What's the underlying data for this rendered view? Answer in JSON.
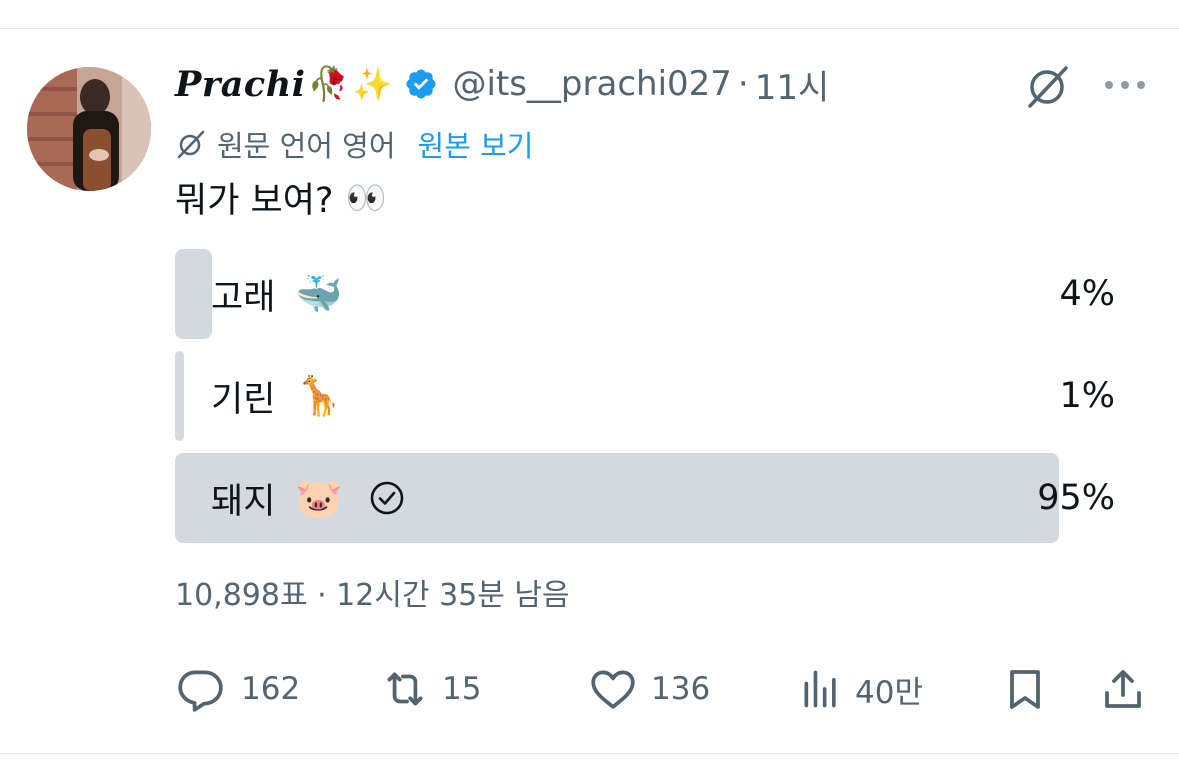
{
  "author": {
    "display_name": "Prachi",
    "name_emojis": [
      "🥀",
      "✨"
    ],
    "verified": true,
    "handle": "@its__prachi027",
    "separator": "·",
    "time": "11시"
  },
  "translation": {
    "label": "원문 언어 영어",
    "show_original": "원본 보기"
  },
  "tweet": {
    "text": "뭐가 보여?",
    "emoji": "👀"
  },
  "poll": {
    "options": [
      {
        "label": "고래",
        "emoji": "🐳",
        "percent_text": "4%",
        "percent": 4,
        "selected": false
      },
      {
        "label": "기린",
        "emoji": "🦒",
        "percent_text": "1%",
        "percent": 1,
        "selected": false
      },
      {
        "label": "돼지",
        "emoji": "🐷",
        "percent_text": "95%",
        "percent": 95,
        "selected": true
      }
    ],
    "meta": "10,898표 · 12시간 35분 남음"
  },
  "actions": {
    "replies": "162",
    "reposts": "15",
    "likes": "136",
    "views": "40만"
  },
  "colors": {
    "text_primary": "#0f1419",
    "text_secondary": "#536471",
    "link": "#1d9bf0",
    "verified": "#1d9bf0",
    "poll_bar": "#d3d9de"
  },
  "icons": {
    "grok": "grok-slash-icon",
    "more": "more-dots-icon",
    "translate": "grok-slash-icon",
    "verified": "verified-badge-icon",
    "check": "check-circle-icon",
    "reply": "reply-bubble-icon",
    "repost": "repost-icon",
    "like": "heart-icon",
    "views": "views-bar-icon",
    "bookmark": "bookmark-icon",
    "share": "share-icon"
  }
}
